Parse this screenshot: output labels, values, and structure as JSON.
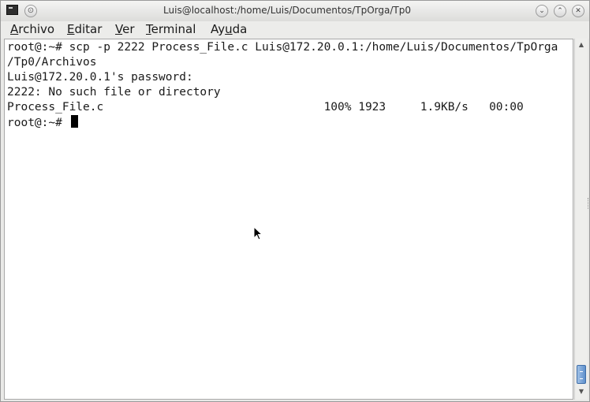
{
  "window": {
    "title": "Luis@localhost:/home/Luis/Documentos/TpOrga/Tp0",
    "pin_glyph": "⊙",
    "minimize_glyph": "⌄",
    "maximize_glyph": "⌃",
    "close_glyph": "✕"
  },
  "menu": {
    "items": [
      {
        "label": "Archivo",
        "mnemonic": "A"
      },
      {
        "label": "Editar",
        "mnemonic": "E"
      },
      {
        "label": "Ver",
        "mnemonic": "V"
      },
      {
        "label": "Terminal",
        "mnemonic": "T"
      },
      {
        "label": "Ayuda",
        "mnemonic": "u"
      }
    ]
  },
  "terminal": {
    "lines": [
      "root@:~# scp -p 2222 Process_File.c Luis@172.20.0.1:/home/Luis/Documentos/TpOrga",
      "/Tp0/Archivos",
      "Luis@172.20.0.1's password:",
      "2222: No such file or directory",
      "Process_File.c                                100% 1923     1.9KB/s   00:00",
      "root@:~# "
    ]
  },
  "scrollbar": {
    "up_glyph": "▲",
    "down_glyph": "▼",
    "position_fraction": 1.0
  },
  "icons": {
    "app": "terminal-icon",
    "pointer": "mouse-pointer-icon"
  }
}
